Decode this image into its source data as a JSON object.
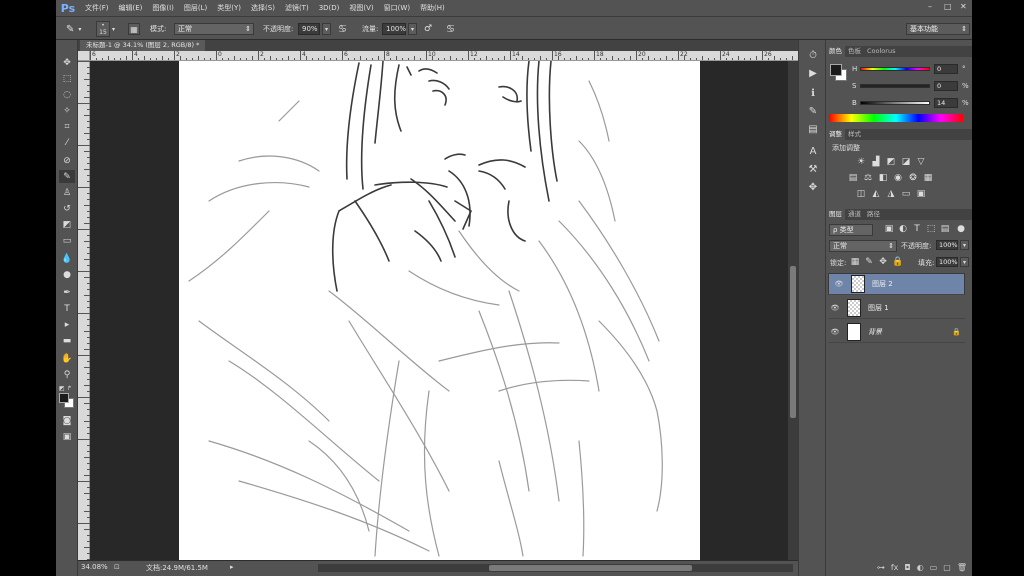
{
  "app": {
    "logo": "Ps"
  },
  "menu": [
    "文件(F)",
    "编辑(E)",
    "图像(I)",
    "图层(L)",
    "类型(Y)",
    "选择(S)",
    "滤镜(T)",
    "3D(D)",
    "视图(V)",
    "窗口(W)",
    "帮助(H)"
  ],
  "options": {
    "brush_size": "15",
    "mode_label": "模式:",
    "mode_value": "正常",
    "opacity_label": "不透明度:",
    "opacity_value": "90%",
    "flow_label": "流量:",
    "flow_value": "100%",
    "workspace": "基本功能"
  },
  "document": {
    "tab_title": "未标题-1 @ 34.1% (图层 2, RGB/8) *",
    "zoom": "34.08%",
    "doc_size": "文档:24.9M/61.5M"
  },
  "ruler_top": [
    "6",
    "4",
    "2",
    "0",
    "2",
    "4",
    "6",
    "8",
    "10",
    "12",
    "14",
    "16",
    "18",
    "20",
    "22",
    "24",
    "26"
  ],
  "color_panel": {
    "tabs": [
      "颜色",
      "色板",
      "Coolorus"
    ],
    "h_label": "H",
    "h_value": "0",
    "s_label": "S",
    "s_value": "0",
    "b_label": "B",
    "b_value": "14",
    "pct": "%",
    "deg": "°"
  },
  "adjust_panel": {
    "tabs": [
      "调整",
      "样式"
    ],
    "title": "添加调整"
  },
  "layers_panel": {
    "tabs": [
      "图层",
      "通道",
      "路径"
    ],
    "filter": "ρ 类型",
    "blend_mode": "正常",
    "opacity_label": "不透明度:",
    "opacity_value": "100%",
    "lock_label": "锁定:",
    "fill_label": "填充:",
    "fill_value": "100%",
    "layers": [
      {
        "name": "图层 2",
        "selected": true,
        "thumb": "transparent"
      },
      {
        "name": "图层 1",
        "selected": false,
        "thumb": "transparent"
      },
      {
        "name": "背景",
        "selected": false,
        "thumb": "white",
        "locked": true
      }
    ]
  },
  "colors": {
    "fg": "#1c1c1c",
    "bg": "#ffffff",
    "selected_layer": "#6e84a8"
  }
}
